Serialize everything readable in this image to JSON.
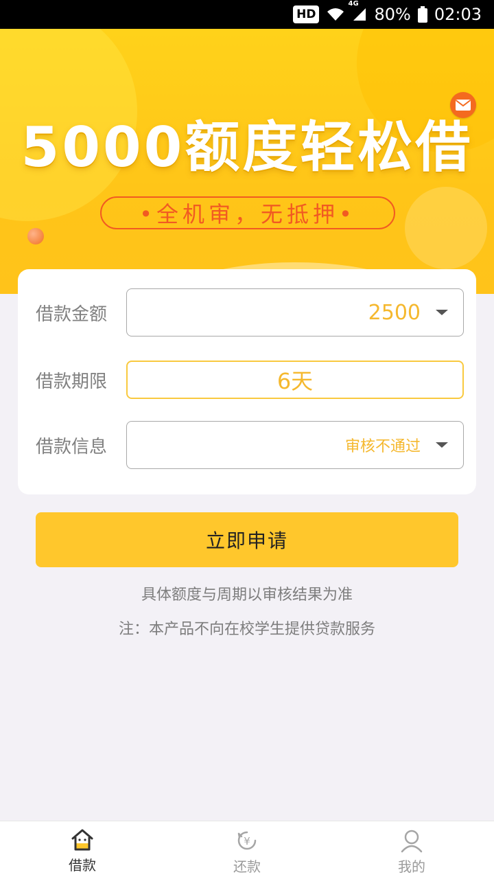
{
  "status_bar": {
    "hd": "HD",
    "network": "4G",
    "battery": "80%",
    "time": "02:03"
  },
  "banner": {
    "title": "5000额度轻松借",
    "tagline": "•全机审，无抵押•"
  },
  "form": {
    "amount": {
      "label": "借款金额",
      "value": "2500"
    },
    "term": {
      "label": "借款期限",
      "value": "6天"
    },
    "info": {
      "label": "借款信息",
      "value": "审核不通过"
    }
  },
  "apply_button": "立即申请",
  "notes": {
    "line1": "具体额度与周期以审核结果为准",
    "line2": "注：本产品不向在校学生提供贷款服务"
  },
  "nav": {
    "items": [
      {
        "label": "借款",
        "icon": "home-icon",
        "active": true
      },
      {
        "label": "还款",
        "icon": "repay-icon",
        "active": false
      },
      {
        "label": "我的",
        "icon": "user-icon",
        "active": false
      }
    ]
  },
  "colors": {
    "accent": "#ffc72c",
    "value_text": "#f5b82e",
    "tagline": "#f15a22",
    "mail": "#f46a1f"
  }
}
